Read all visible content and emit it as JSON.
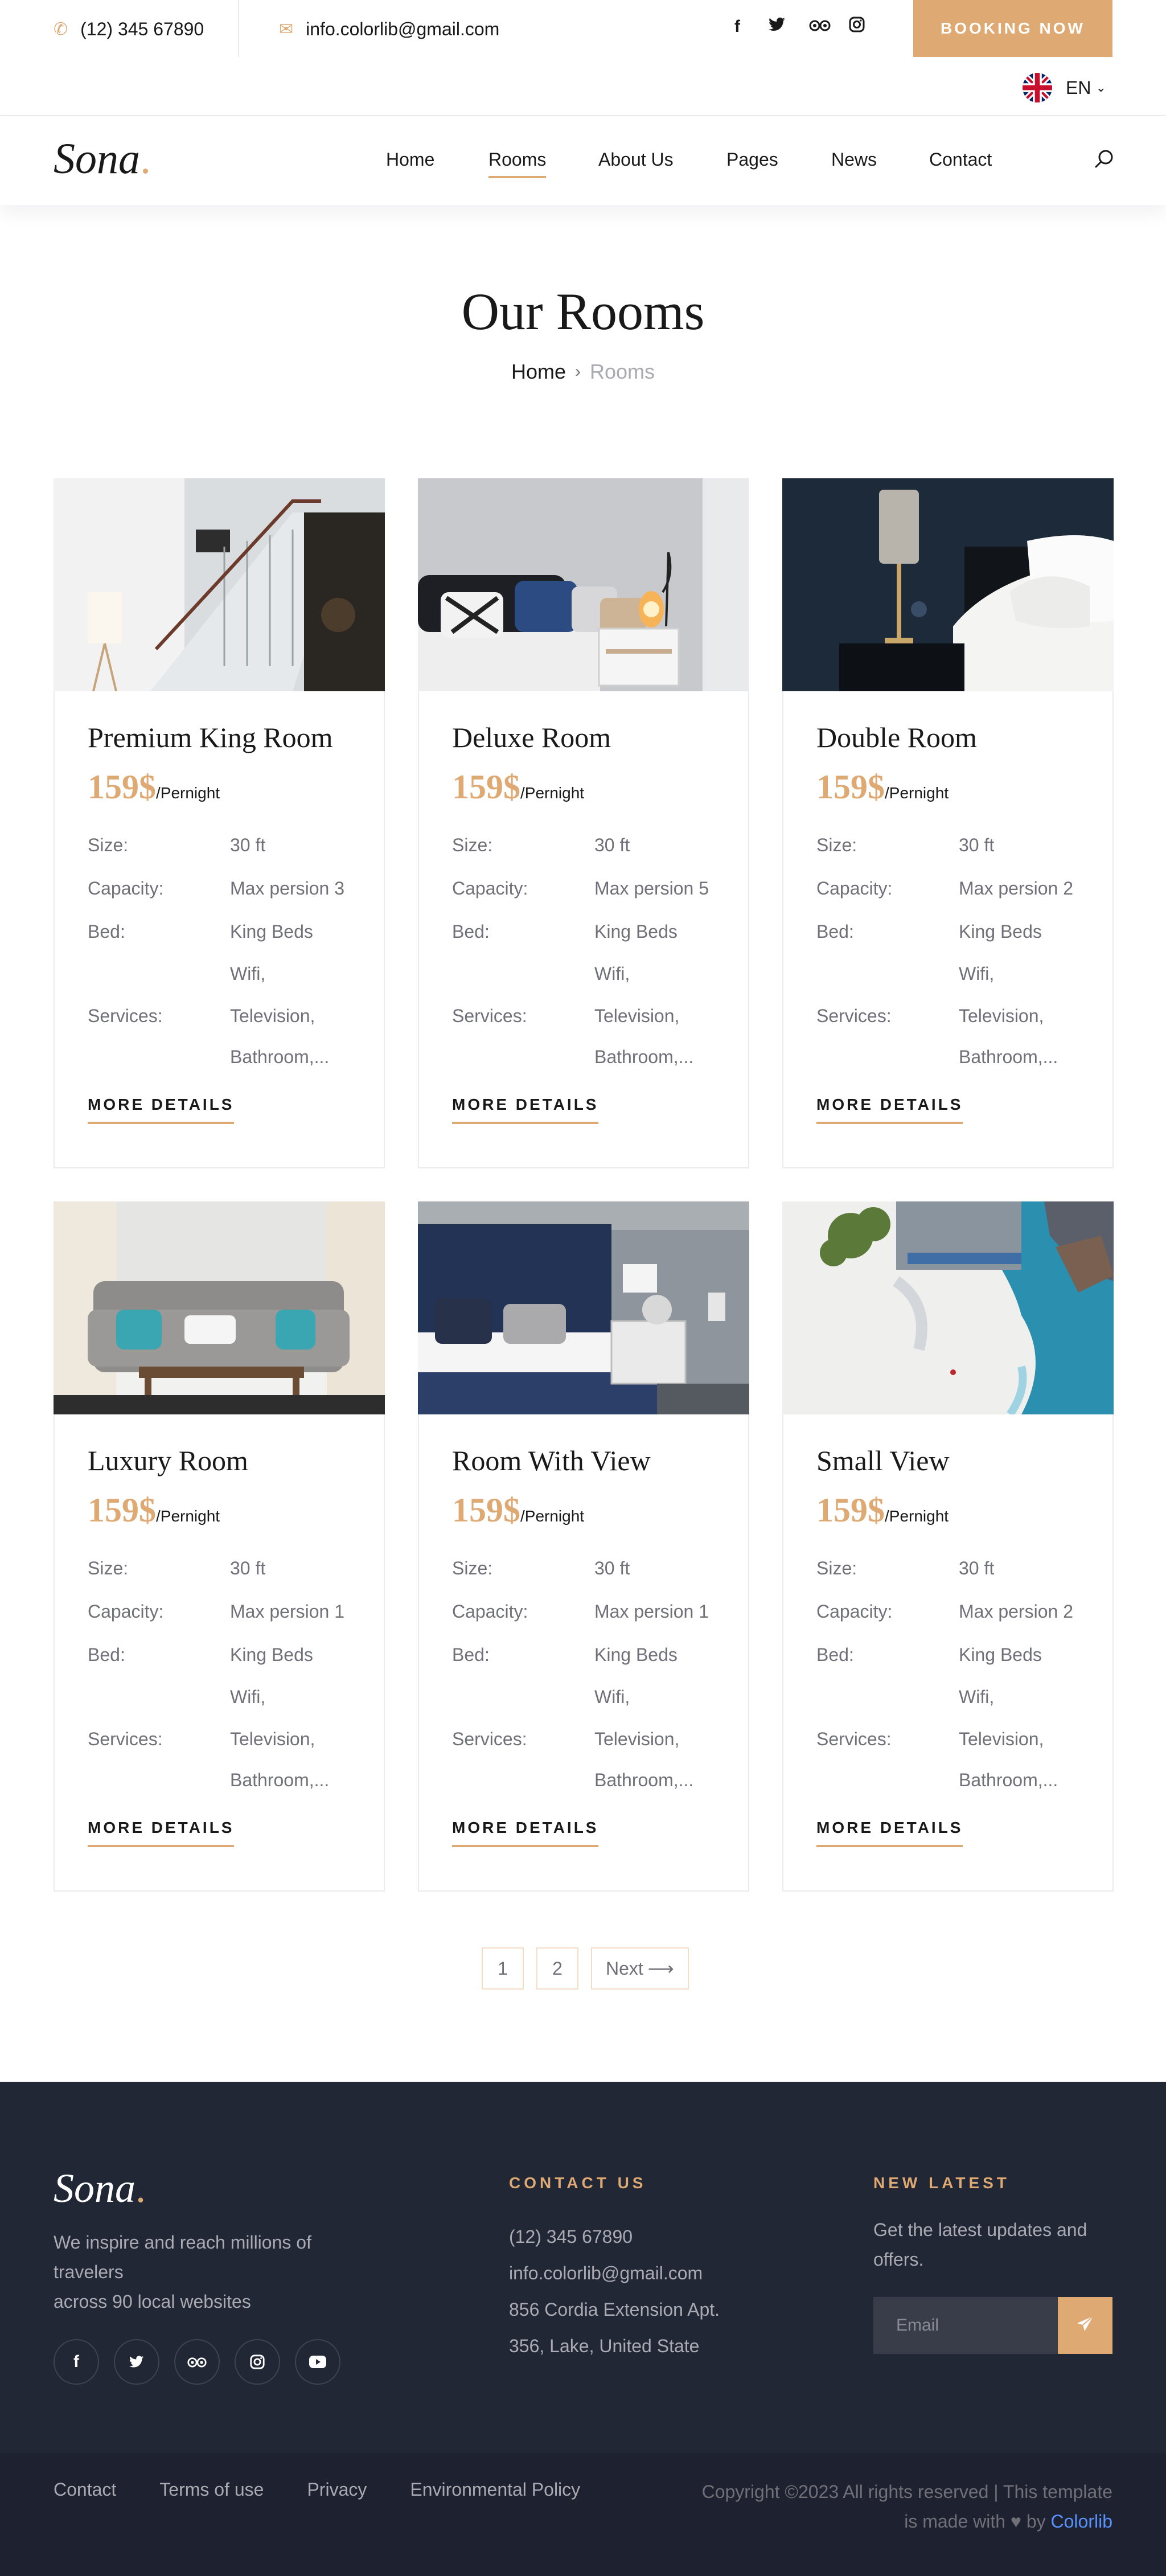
{
  "topbar": {
    "phone": "(12) 345 67890",
    "email": "info.colorlib@gmail.com",
    "social_icons": [
      "facebook-icon",
      "twitter-icon",
      "tripadvisor-icon",
      "instagram-icon"
    ],
    "booking_label": "BOOKING NOW",
    "language": "EN"
  },
  "nav": {
    "logo": "Sona",
    "logo_dot": ".",
    "items": [
      "Home",
      "Rooms",
      "About Us",
      "Pages",
      "News",
      "Contact"
    ],
    "active": "Rooms"
  },
  "hero": {
    "title": "Our Rooms",
    "breadcrumb": [
      "Home",
      "Rooms"
    ]
  },
  "room_labels": {
    "size": "Size:",
    "capacity": "Capacity:",
    "bed": "Bed:",
    "services": "Services:",
    "per_night": "/Pernight",
    "more": "MORE DETAILS"
  },
  "rooms": [
    {
      "name": "Premium King Room",
      "price": "159$",
      "size": "30 ft",
      "capacity": "Max persion 3",
      "bed": "King Beds",
      "services": [
        "Wifi,",
        "Television,",
        "Bathroom,..."
      ]
    },
    {
      "name": "Deluxe Room",
      "price": "159$",
      "size": "30 ft",
      "capacity": "Max persion 5",
      "bed": "King Beds",
      "services": [
        "Wifi,",
        "Television,",
        "Bathroom,..."
      ]
    },
    {
      "name": "Double Room",
      "price": "159$",
      "size": "30 ft",
      "capacity": "Max persion 2",
      "bed": "King Beds",
      "services": [
        "Wifi,",
        "Television,",
        "Bathroom,..."
      ]
    },
    {
      "name": "Luxury Room",
      "price": "159$",
      "size": "30 ft",
      "capacity": "Max persion 1",
      "bed": "King Beds",
      "services": [
        "Wifi,",
        "Television,",
        "Bathroom,..."
      ]
    },
    {
      "name": "Room With View",
      "price": "159$",
      "size": "30 ft",
      "capacity": "Max persion 1",
      "bed": "King Beds",
      "services": [
        "Wifi,",
        "Television,",
        "Bathroom,..."
      ]
    },
    {
      "name": "Small View",
      "price": "159$",
      "size": "30 ft",
      "capacity": "Max persion 2",
      "bed": "King Beds",
      "services": [
        "Wifi,",
        "Television,",
        "Bathroom,..."
      ]
    }
  ],
  "pagination": {
    "pages": [
      "1",
      "2"
    ],
    "next": "Next"
  },
  "footer": {
    "logo": "Sona",
    "description_lines": [
      "We inspire and reach millions of",
      "travelers",
      "across 90 local websites"
    ],
    "social_icons": [
      "facebook-icon",
      "twitter-icon",
      "tripadvisor-icon",
      "instagram-icon",
      "youtube-icon"
    ],
    "contact_heading": "CONTACT US",
    "contact_lines": [
      "(12) 345 67890",
      "info.colorlib@gmail.com",
      "856 Cordia Extension Apt.",
      "356, Lake, United State"
    ],
    "news_heading": "NEW LATEST",
    "news_desc": "Get the latest updates and offers.",
    "email_placeholder": "Email",
    "links": [
      "Contact",
      "Terms of use",
      "Privacy",
      "Environmental Policy"
    ],
    "copyright_1": "Copyright ©2023 All rights reserved | This template",
    "copyright_2": "is made with",
    "copyright_by": "by",
    "copyright_brand": "Colorlib"
  },
  "colors": {
    "accent": "#dfa974",
    "footer_bg": "#222736",
    "link": "#5892ff"
  }
}
